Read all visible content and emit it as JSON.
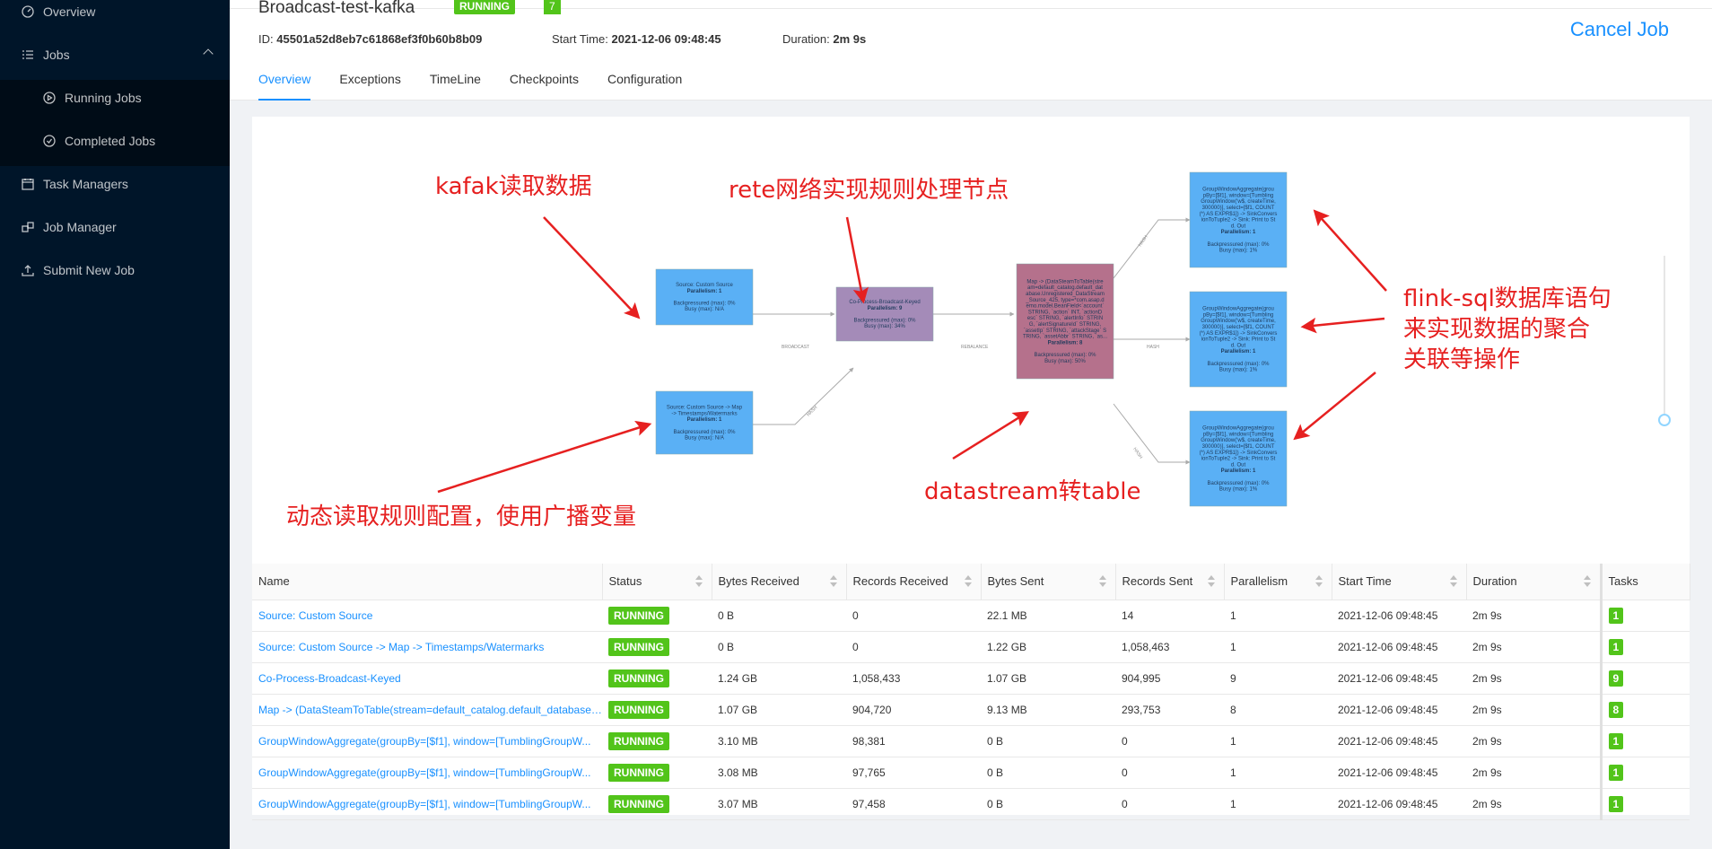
{
  "sidebar": {
    "items": [
      {
        "label": "Overview",
        "icon": "dashboard-icon"
      },
      {
        "label": "Jobs",
        "icon": "list-icon"
      },
      {
        "label": "Running Jobs",
        "icon": "play-circle-icon"
      },
      {
        "label": "Completed Jobs",
        "icon": "check-circle-icon"
      },
      {
        "label": "Task Managers",
        "icon": "schedule-icon"
      },
      {
        "label": "Job Manager",
        "icon": "build-icon"
      },
      {
        "label": "Submit New Job",
        "icon": "upload-icon"
      }
    ]
  },
  "job": {
    "title": "Broadcast-test-kafka",
    "status": "RUNNING",
    "count": "7",
    "id_label": "ID:",
    "id": "45501a52d8eb7c61868ef3f0b60b8b09",
    "start_label": "Start Time:",
    "start": "2021-12-06 09:48:45",
    "duration_label": "Duration:",
    "duration": "2m 9s",
    "cancel": "Cancel Job"
  },
  "tabs": [
    "Overview",
    "Exceptions",
    "TimeLine",
    "Checkpoints",
    "Configuration"
  ],
  "graph": {
    "nodes": {
      "n1": {
        "lines": [
          "Source: Custom Source",
          "Parallelism: 1",
          "",
          "Backpressured (max): 0%",
          "Busy (max): N/A"
        ]
      },
      "n2": {
        "lines": [
          "Source: Custom Source -> Map",
          "-> Timestamps/Watermarks",
          "Parallelism: 1",
          "",
          "Backpressured (max): 0%",
          "Busy (max): N/A"
        ]
      },
      "n3": {
        "lines": [
          "Co-Process-Broadcast-Keyed",
          "Parallelism: 9",
          "",
          "Backpressured (max): 0%",
          "Busy (max): 34%"
        ]
      },
      "n4": {
        "lines": [
          "Map -> (DataSteamToTable(stre",
          "am=default_catalog.default_dat",
          "abase.Unregistered_DataStream",
          "_Source_425, type=*com.asap.d",
          "emo.model.BeanField<`account`",
          "STRING, `action` INT, `actionD",
          "esc` STRING, `alertInfo` STRIN",
          "G, `alertSignatureId` STRING,",
          "`assetIp` STRING, `attackStage` S",
          "TRING, `assetAbbr` STRING, `as...",
          "Parallelism: 8",
          "",
          "Backpressured (max): 0%",
          "Busy (max): 50%"
        ]
      },
      "n5": {
        "lines": [
          "GroupWindowAggregate(grou",
          "pBy=[$f1], window=[Tumbling",
          "GroupWindow('w$, createTime,",
          "300000)], select=[$f1, COUNT",
          "(*) AS EXPR$1]) -> SinkConvers",
          "ionToTuple2 -> Sink: Print to St",
          "d. Out",
          "Parallelism: 1",
          "",
          "Backpressured (max): 0%",
          "Busy (max): 1%"
        ]
      },
      "n6": {
        "lines": [
          "GroupWindowAggregate(grou",
          "pBy=[$f1], window=[Tumbling",
          "GroupWindow('w$, createTime,",
          "300000)], select=[$f1, COUNT",
          "(*) AS EXPR$1]) -> SinkConvers",
          "ionToTuple2 -> Sink: Print to St",
          "d. Out",
          "Parallelism: 1",
          "",
          "Backpressured (max): 0%",
          "Busy (max): 1%"
        ]
      },
      "n7": {
        "lines": [
          "GroupWindowAggregate(grou",
          "pBy=[$f1], window=[Tumbling",
          "GroupWindow('w$, createTime,",
          "300000)], select=[$f1, COUNT",
          "(*) AS EXPR$1]) -> SinkConvers",
          "ionToTuple2 -> Sink: Print to St",
          "d. Out",
          "Parallelism: 1",
          "",
          "Backpressured (max): 0%",
          "Busy (max): 1%"
        ]
      }
    },
    "edges": {
      "e1": "BROADCAST",
      "e2": "HASH",
      "e3": "REBALANCE",
      "e4": "HASH",
      "e5": "HASH",
      "e6": "HASH"
    },
    "colors": {
      "blue": "#5ab0f5",
      "purple": "#a48bb8",
      "magenta": "#b5718c",
      "annotation": "#e62020"
    },
    "annotations": {
      "kafka": "kafak读取数据",
      "rete": "rete网络实现规则处理节点",
      "flinksql": [
        "flink-sql数据库语句",
        "来实现数据的聚合",
        "关联等操作"
      ],
      "datastream": "datastream转table",
      "broadcast": "动态读取规则配置，使用广播变量"
    },
    "more": "•••"
  },
  "table": {
    "headers": [
      "Name",
      "Status",
      "Bytes Received",
      "Records Received",
      "Bytes Sent",
      "Records Sent",
      "Parallelism",
      "Start Time",
      "Duration",
      "Tasks"
    ],
    "rows": [
      [
        "Source: Custom Source",
        "RUNNING",
        "0 B",
        "0",
        "22.1 MB",
        "14",
        "1",
        "2021-12-06 09:48:45",
        "2m 9s",
        "1"
      ],
      [
        "Source: Custom Source -> Map -> Timestamps/Watermarks",
        "RUNNING",
        "0 B",
        "0",
        "1.22 GB",
        "1,058,463",
        "1",
        "2021-12-06 09:48:45",
        "2m 9s",
        "1"
      ],
      [
        "Co-Process-Broadcast-Keyed",
        "RUNNING",
        "1.24 GB",
        "1,058,433",
        "1.07 GB",
        "904,995",
        "9",
        "2021-12-06 09:48:45",
        "2m 9s",
        "9"
      ],
      [
        "Map -> (DataSteamToTable(stream=default_catalog.default_database....",
        "RUNNING",
        "1.07 GB",
        "904,720",
        "9.13 MB",
        "293,753",
        "8",
        "2021-12-06 09:48:45",
        "2m 9s",
        "8"
      ],
      [
        "GroupWindowAggregate(groupBy=[$f1], window=[TumblingGroupW...",
        "RUNNING",
        "3.10 MB",
        "98,381",
        "0 B",
        "0",
        "1",
        "2021-12-06 09:48:45",
        "2m 9s",
        "1"
      ],
      [
        "GroupWindowAggregate(groupBy=[$f1], window=[TumblingGroupW...",
        "RUNNING",
        "3.08 MB",
        "97,765",
        "0 B",
        "0",
        "1",
        "2021-12-06 09:48:45",
        "2m 9s",
        "1"
      ],
      [
        "GroupWindowAggregate(groupBy=[$f1], window=[TumblingGroupW...",
        "RUNNING",
        "3.07 MB",
        "97,458",
        "0 B",
        "0",
        "1",
        "2021-12-06 09:48:45",
        "2m 9s",
        "1"
      ]
    ]
  }
}
